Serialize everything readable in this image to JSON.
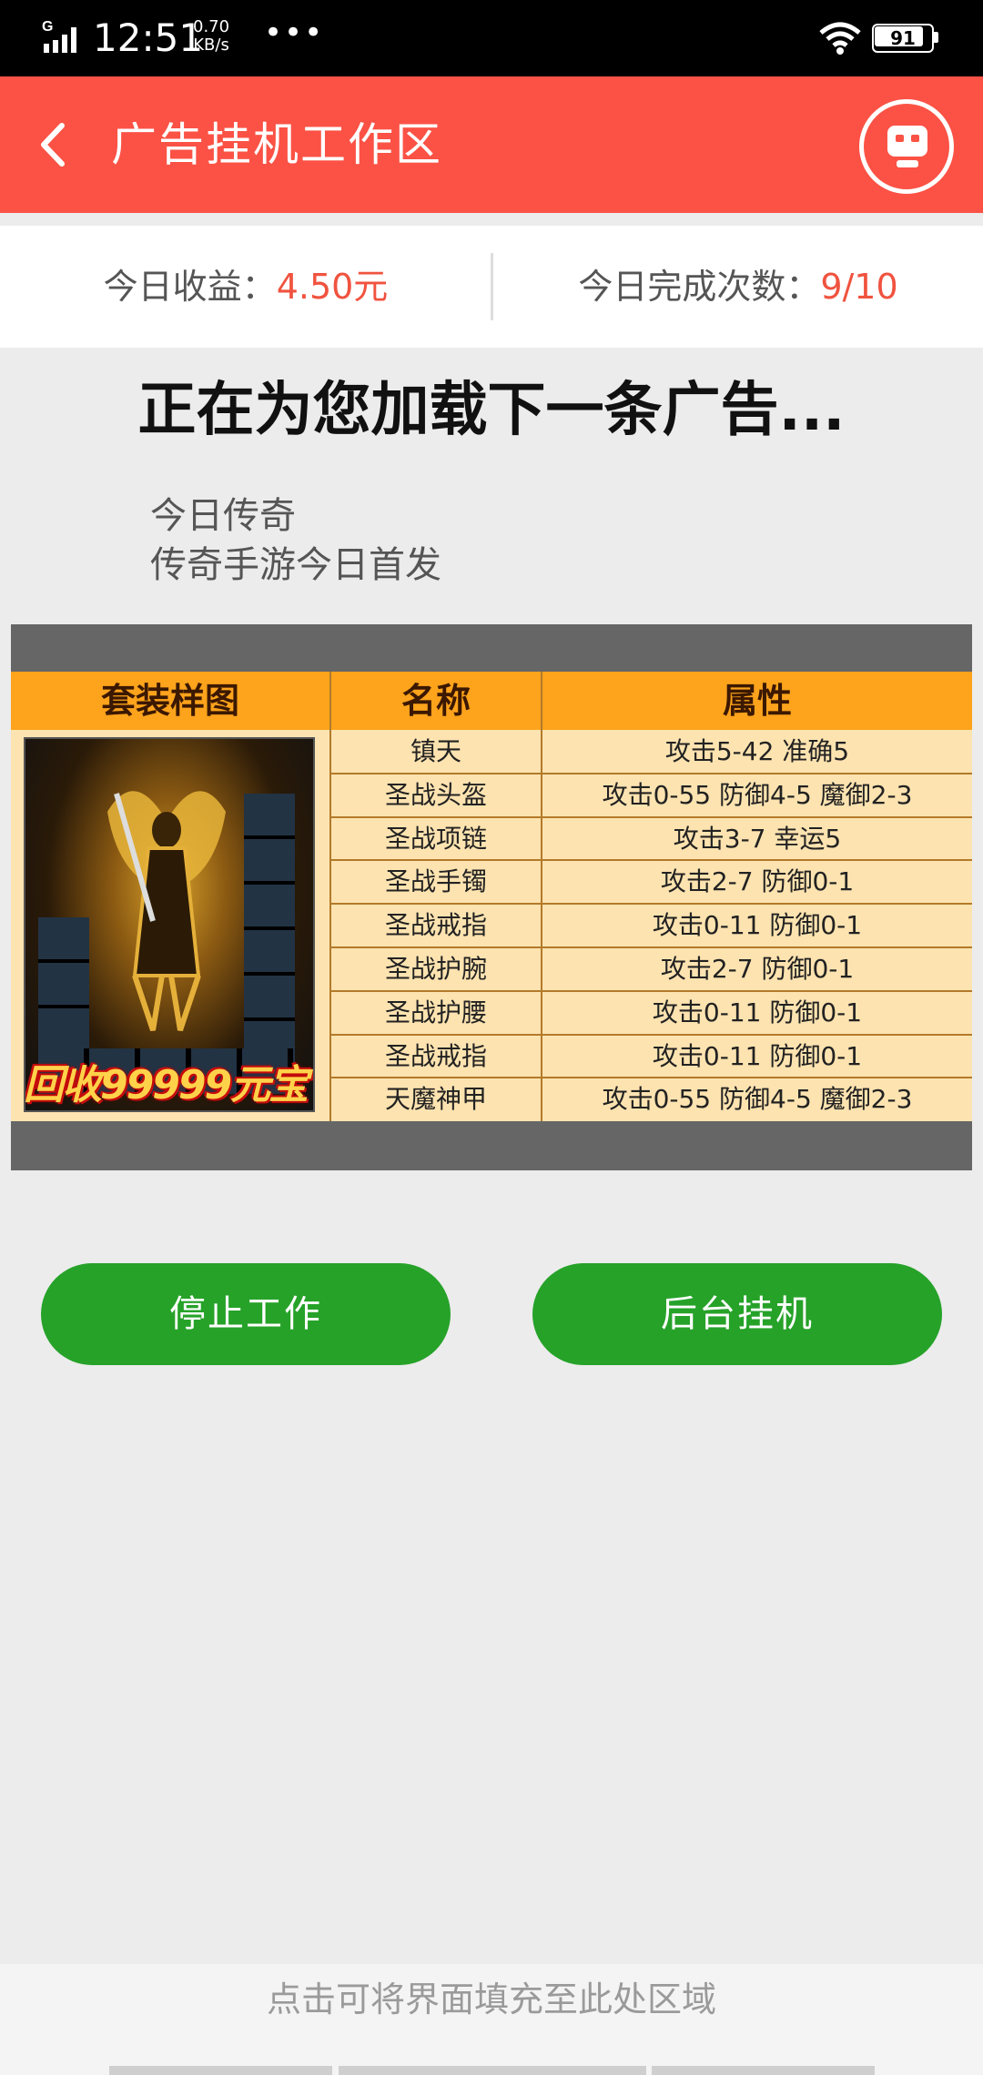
{
  "status_bar": {
    "network": "G",
    "time": "12:51",
    "speed_value": "0.70",
    "speed_unit": "KB/s",
    "more": "•••",
    "battery": "91"
  },
  "header": {
    "title": "广告挂机工作区",
    "back_icon": "chevron-left-icon",
    "robot_icon": "robot-icon",
    "background": "#fb5245"
  },
  "stats": {
    "earnings_label": "今日收益：",
    "earnings_value": "4.50元",
    "completions_label": "今日完成次数：",
    "completions_value": "9/10"
  },
  "loading_text": "正在为您加载下一条广告...",
  "ad": {
    "line1": "今日传奇",
    "line2": "传奇手游今日首发",
    "table_headers": [
      "套装样图",
      "名称",
      "属性"
    ],
    "rows": [
      {
        "name": "镇天",
        "attr": "攻击5-42  准确5"
      },
      {
        "name": "圣战头盔",
        "attr": "攻击0-55  防御4-5  魔御2-3"
      },
      {
        "name": "圣战项链",
        "attr": "攻击3-7  幸运5"
      },
      {
        "name": "圣战手镯",
        "attr": "攻击2-7  防御0-1"
      },
      {
        "name": "圣战戒指",
        "attr": "攻击0-11  防御0-1"
      },
      {
        "name": "圣战护腕",
        "attr": "攻击2-7  防御0-1"
      },
      {
        "name": "圣战护腰",
        "attr": "攻击0-11  防御0-1"
      },
      {
        "name": "圣战戒指",
        "attr": "攻击0-11  防御0-1"
      },
      {
        "name": "天魔神甲",
        "attr": "攻击0-55  防御4-5  魔御2-3"
      }
    ],
    "promo": "回收99999元宝"
  },
  "buttons": {
    "stop": "停止工作",
    "background": "后台挂机",
    "color": "#26a229"
  },
  "fill_area_text": "点击可将界面填充至此处区域"
}
